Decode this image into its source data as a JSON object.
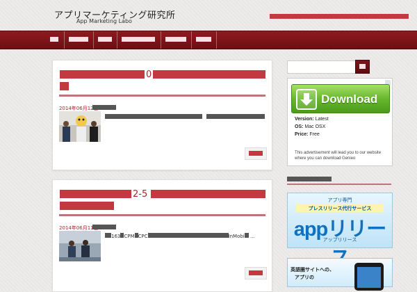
{
  "header": {
    "site_title_jp": "アプリマーケティング研究所",
    "site_title_en": "App Marketing Labo",
    "tagline": ""
  },
  "nav": {
    "items": [
      {
        "label": ""
      },
      {
        "label": ""
      },
      {
        "label": ""
      },
      {
        "label": ""
      },
      {
        "label": ""
      },
      {
        "label": ""
      }
    ]
  },
  "posts": [
    {
      "title_line1": "0",
      "title_line2": "",
      "date": "2014年06月12日",
      "category": "",
      "excerpt": "",
      "more_label": ""
    },
    {
      "title_line1": "2-5",
      "title_line2": "",
      "date": "2014年06月11日",
      "category": "",
      "excerpt_line1_a": "",
      "excerpt_line1_b": "163",
      "excerpt_line1_c": "CPM",
      "excerpt_line1_d": "CPC",
      "excerpt_line1_e": "InMobi",
      "excerpt_ellipsis": "...",
      "more_label": ""
    }
  ],
  "sidebar": {
    "search": {
      "placeholder": "",
      "button_label": ""
    },
    "ad": {
      "button_label": "Download",
      "version_label": "Version:",
      "version_value": "Latest",
      "os_label": "OS:",
      "os_value": "Mac OSX",
      "price_label": "Price:",
      "price_value": "Free",
      "note": "This advertisement will lead you to our website where you can download Genieo"
    },
    "widget_title": "",
    "banner1": {
      "top": "アプリ専門",
      "pill": "プレスリリース代行サービス",
      "app_text": "appリリース",
      "sub": "アップリリース"
    },
    "banner2": {
      "line1": "英語圏サイトへの、",
      "line2": "アプリの"
    }
  },
  "colors": {
    "accent": "#a8242c",
    "nav_bg": "#7a141a",
    "download_green": "#5fb02a"
  }
}
